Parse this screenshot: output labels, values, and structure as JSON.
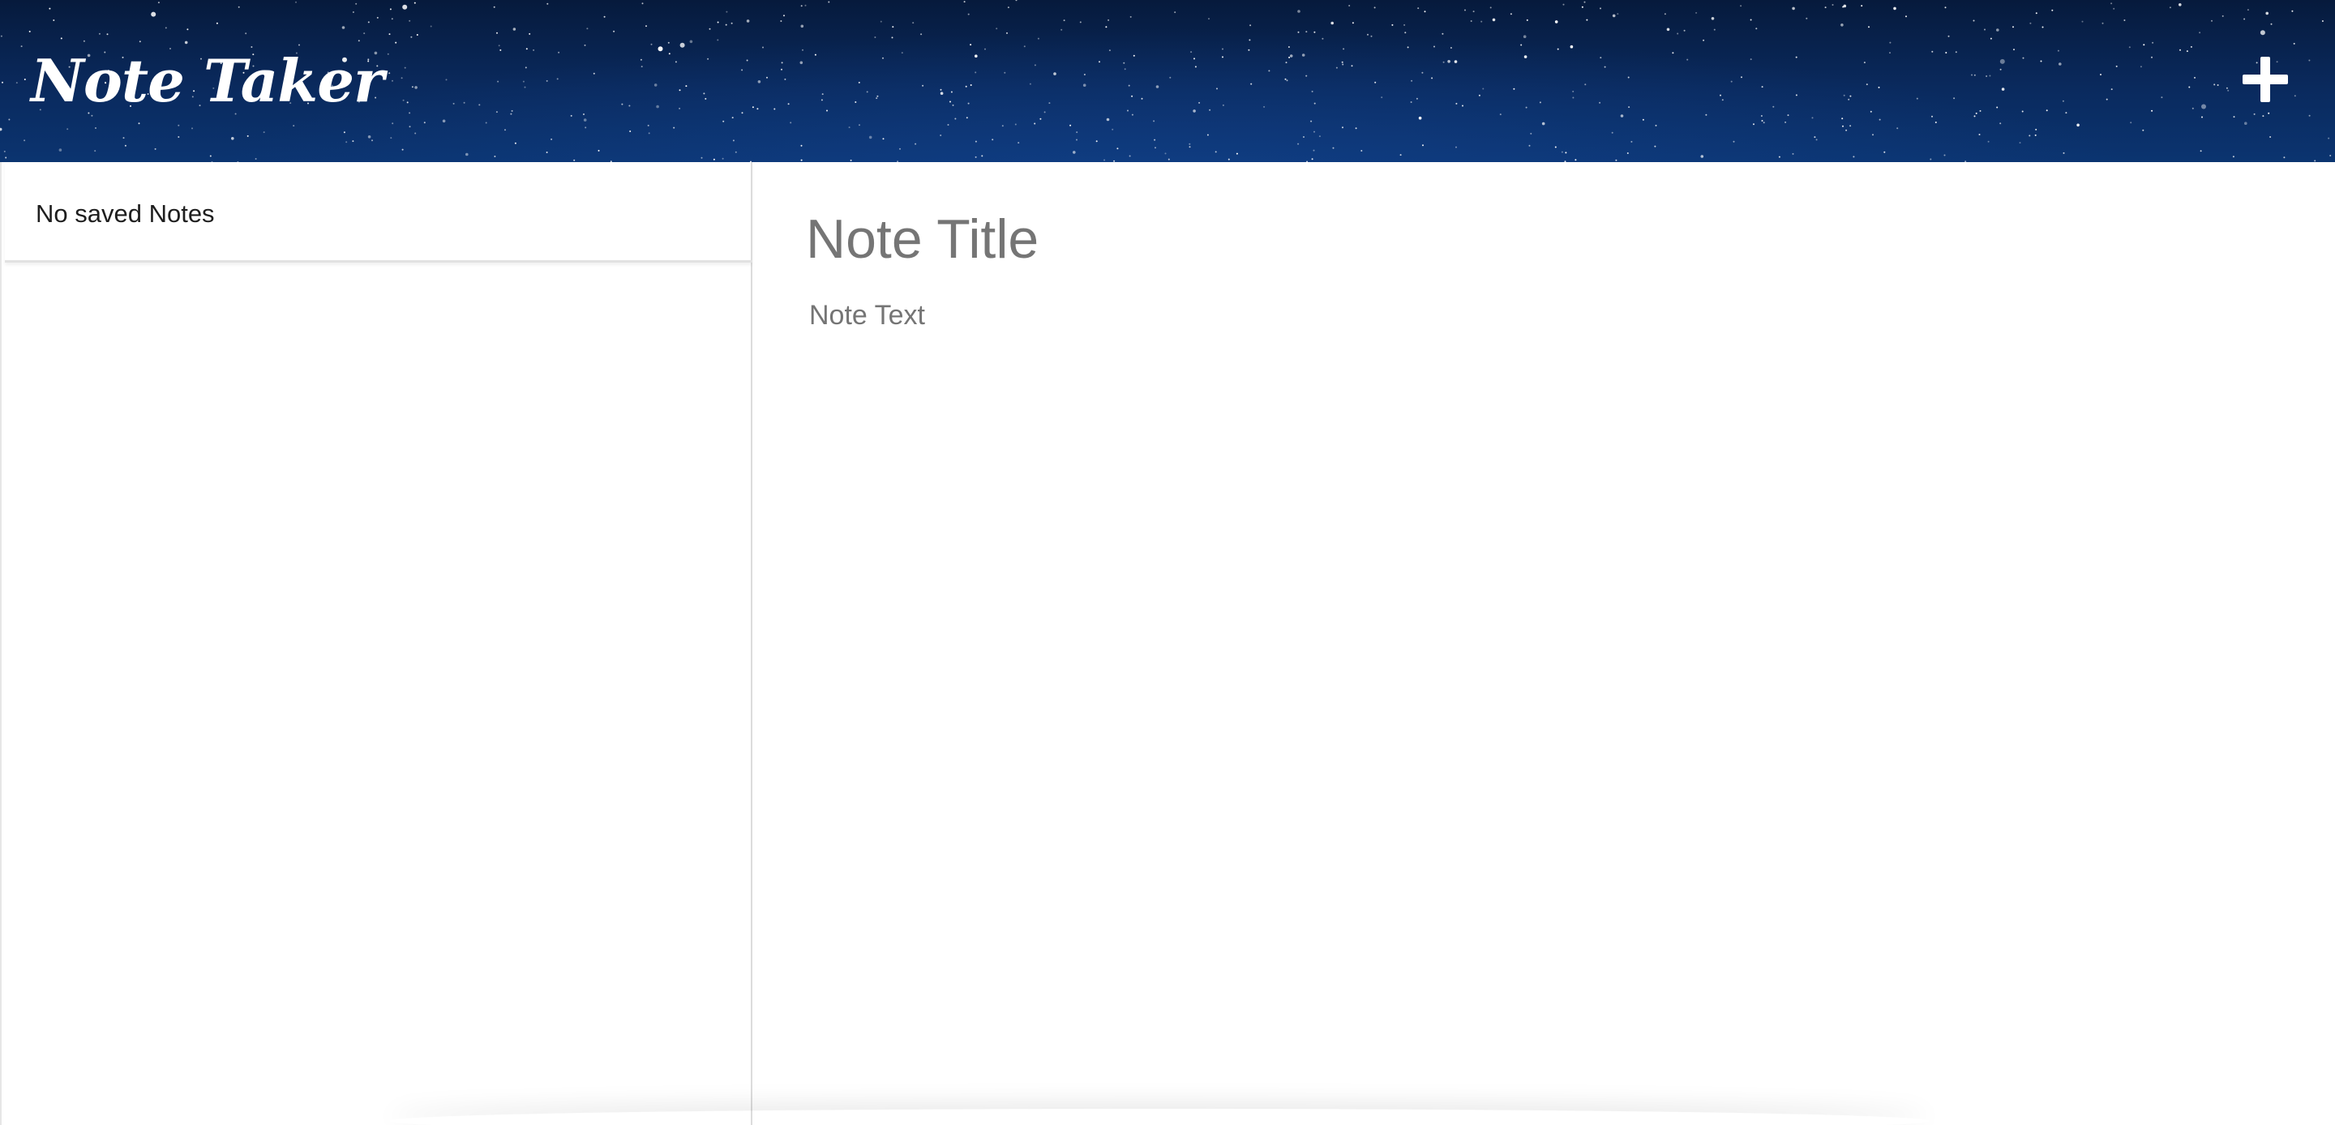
{
  "navbar": {
    "brand": "Note Taker",
    "add_note_icon": "plus-icon",
    "background": "starry-night",
    "colors": {
      "bg_top": "#061a3c",
      "bg_bottom": "#0b3470",
      "text": "#ffffff"
    }
  },
  "sidebar": {
    "empty_message": "No saved Notes"
  },
  "editor": {
    "title_placeholder": "Note Title",
    "text_placeholder": "Note Text",
    "placeholder_color": "#757575"
  }
}
